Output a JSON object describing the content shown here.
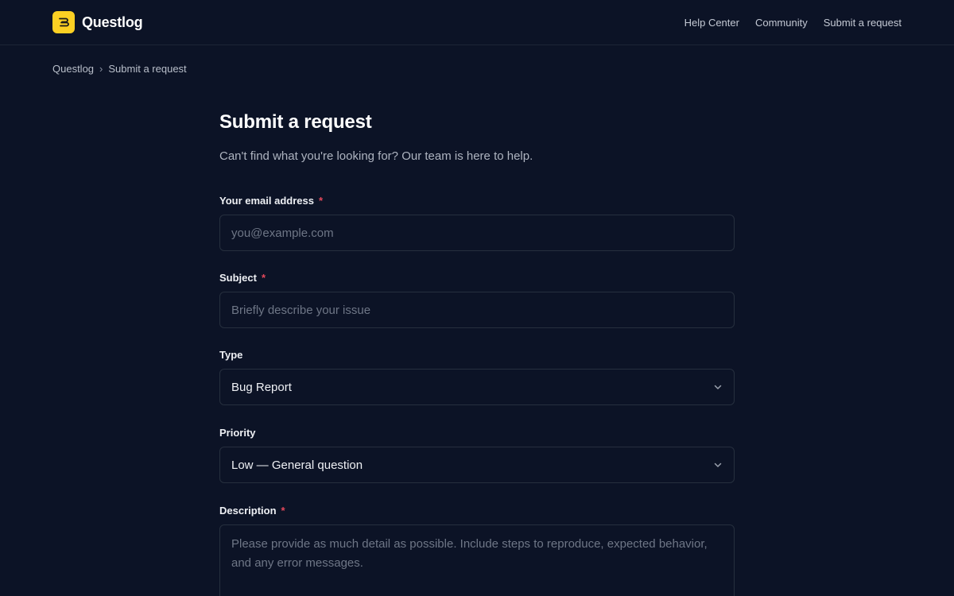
{
  "header": {
    "brand_name": "Questlog",
    "nav": [
      {
        "label": "Help Center"
      },
      {
        "label": "Community"
      },
      {
        "label": "Submit a request"
      }
    ]
  },
  "breadcrumb": {
    "root": "Questlog",
    "separator": "›",
    "current": "Submit a request"
  },
  "page": {
    "title": "Submit a request",
    "subtitle": "Can't find what you're looking for? Our team is here to help."
  },
  "form": {
    "email": {
      "label": "Your email address",
      "required_mark": "*",
      "placeholder": "you@example.com",
      "value": ""
    },
    "subject": {
      "label": "Subject",
      "required_mark": "*",
      "placeholder": "Briefly describe your issue",
      "value": ""
    },
    "type": {
      "label": "Type",
      "selected": "Bug Report"
    },
    "priority": {
      "label": "Priority",
      "selected": "Low — General question"
    },
    "description": {
      "label": "Description",
      "required_mark": "*",
      "placeholder": "Please provide as much detail as possible. Include steps to reproduce, expected behavior, and any error messages.",
      "value": ""
    }
  },
  "colors": {
    "background": "#0c1326",
    "brand_accent": "#fcd023",
    "required": "#e4485b",
    "border": "#262f3e"
  },
  "icons": {
    "logo": "questlog-logo-icon",
    "select_caret": "chevron-down-icon"
  }
}
